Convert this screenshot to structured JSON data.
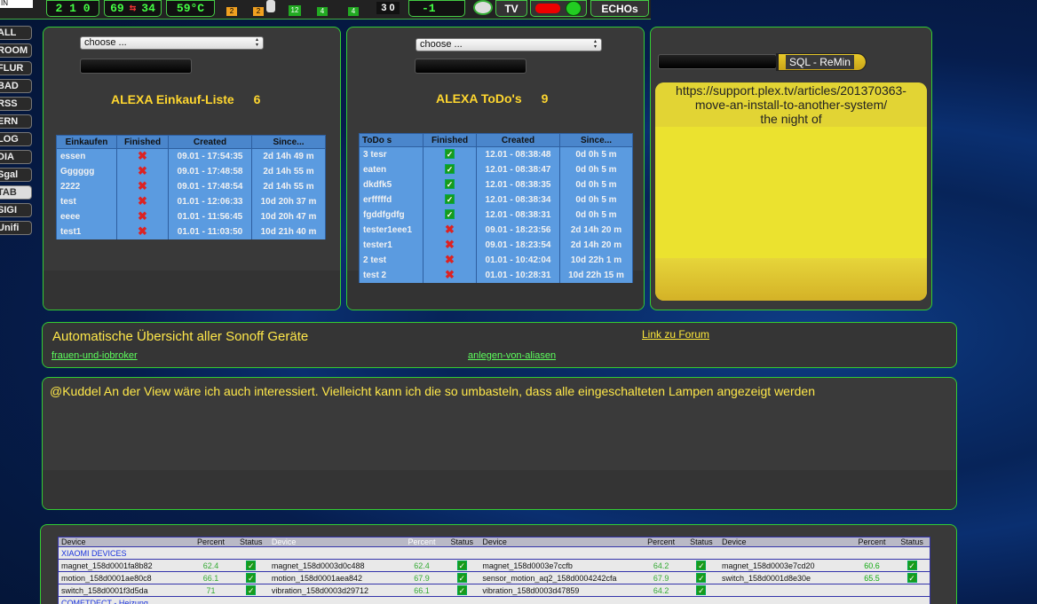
{
  "topbar": {
    "counter": "2 1 0",
    "temp_pair": [
      "69",
      "34"
    ],
    "temp": "59°C",
    "badges": [
      "2",
      "2",
      "12",
      "4",
      "4"
    ],
    "score": "3 0",
    "minus": "-1",
    "tv_label": "TV",
    "echos_label": "ECHOs",
    "top_left": "IN"
  },
  "sidebar": {
    "items": [
      {
        "label": "ALL"
      },
      {
        "label": "ROOM"
      },
      {
        "label": "FLUR"
      },
      {
        "label": "BAD"
      },
      {
        "label": "RSS"
      },
      {
        "label": "ERN"
      },
      {
        "label": "LOG"
      },
      {
        "label": "DIA"
      },
      {
        "label": "Sgal"
      },
      {
        "label": "TAB"
      },
      {
        "label": "SIGI"
      },
      {
        "label": "Unifi"
      }
    ],
    "active": "TAB"
  },
  "einkauf": {
    "select": "choose ...",
    "title": "ALEXA Einkauf-Liste",
    "count": "6",
    "headers": [
      "Einkaufen",
      "Finished",
      "Created",
      "Since..."
    ],
    "rows": [
      {
        "name": "essen",
        "done": false,
        "created": "09.01 - 17:54:35",
        "since": "2d 14h 49 m"
      },
      {
        "name": "Gggggg",
        "done": false,
        "created": "09.01 - 17:48:58",
        "since": "2d 14h 55 m"
      },
      {
        "name": "2222",
        "done": false,
        "created": "09.01 - 17:48:54",
        "since": "2d 14h 55 m"
      },
      {
        "name": "test",
        "done": false,
        "created": "01.01 - 12:06:33",
        "since": "10d 20h 37 m"
      },
      {
        "name": "eeee",
        "done": false,
        "created": "01.01 - 11:56:45",
        "since": "10d 20h 47 m"
      },
      {
        "name": "test1",
        "done": false,
        "created": "01.01 - 11:03:50",
        "since": "10d 21h 40 m"
      }
    ]
  },
  "todo": {
    "select": "choose ...",
    "title": "ALEXA ToDo's",
    "count": "9",
    "headers": [
      "ToDo s",
      "Finished",
      "Created",
      "Since..."
    ],
    "rows": [
      {
        "name": "3 tesr",
        "done": true,
        "created": "12.01 - 08:38:48",
        "since": "0d 0h 5 m"
      },
      {
        "name": "eaten",
        "done": true,
        "created": "12.01 - 08:38:47",
        "since": "0d 0h 5 m"
      },
      {
        "name": "dkdfk5",
        "done": true,
        "created": "12.01 - 08:38:35",
        "since": "0d 0h 5 m"
      },
      {
        "name": "erfffffd",
        "done": true,
        "created": "12.01 - 08:38:34",
        "since": "0d 0h 5 m"
      },
      {
        "name": "fgddfgdfg",
        "done": true,
        "created": "12.01 - 08:38:31",
        "since": "0d 0h 5 m"
      },
      {
        "name": "tester1eee1",
        "done": false,
        "created": "09.01 - 18:23:56",
        "since": "2d 14h 20 m"
      },
      {
        "name": "tester1",
        "done": false,
        "created": "09.01 - 18:23:54",
        "since": "2d 14h 20 m"
      },
      {
        "name": "2 test",
        "done": false,
        "created": "01.01 - 10:42:04",
        "since": "10d 22h 1 m"
      },
      {
        "name": "test 2",
        "done": false,
        "created": "01.01 - 10:28:31",
        "since": "10d 22h 15 m"
      }
    ]
  },
  "sql": {
    "button": "SQL - ReMin",
    "note_lines": [
      "https://support.plex.tv/articles/201370363-",
      "move-an-install-to-another-system/",
      "the night of"
    ]
  },
  "sonoff": {
    "title": "Automatische Übersicht aller Sonoff Geräte",
    "forum_link": "Link zu Forum",
    "link1": "frauen-und-iobroker",
    "link2": "anlegen-von-aliasen"
  },
  "message": {
    "text": "@Kuddel An der View wäre ich auch interessiert. Vielleicht kann ich die so umbasteln, dass alle eingeschalteten Lampen angezeigt werden"
  },
  "devices": {
    "headers": [
      "Device",
      "Percent",
      "Status",
      "Device",
      "Percent",
      "Status",
      "Device",
      "Percent",
      "Status",
      "Device",
      "Percent",
      "Status"
    ],
    "group1": "XIAOMI DEVICES",
    "rows": [
      [
        "magnet_158d0001fa8b82",
        "62.4",
        "magnet_158d0003d0c488",
        "62.4",
        "magnet_158d0003e7ccfb",
        "64.2",
        "magnet_158d0003e7cd20",
        "60.6"
      ],
      [
        "motion_158d0001ae80c8",
        "66.1",
        "motion_158d0001aea842",
        "67.9",
        "sensor_motion_aq2_158d0004242cfa",
        "67.9",
        "switch_158d0001d8e30e",
        "65.5"
      ],
      [
        "switch_158d0001f3d5da",
        "71",
        "vibration_158d0003d29712",
        "66.1",
        "vibration_158d0003d47859",
        "64.2",
        "",
        ""
      ]
    ],
    "group2": "COMETDECT - Heizung"
  },
  "colors": {
    "accent": "#33cc33",
    "title": "#ffd72f",
    "note": "#ebe22f"
  }
}
